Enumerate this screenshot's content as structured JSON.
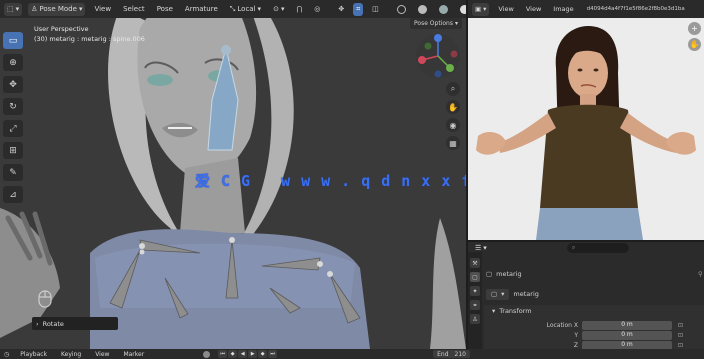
{
  "viewport_header": {
    "mode": "Pose Mode",
    "menus": [
      "View",
      "Select",
      "Pose",
      "Armature"
    ],
    "transform_space": "Local"
  },
  "viewport_info": {
    "perspective": "User Perspective",
    "context": "(30) metarig : metarig : spine.006"
  },
  "pose_options_label": "Pose Options",
  "watermark": "爱CG www.qdnxxfb.cn",
  "operator_panel": {
    "label": "Rotate"
  },
  "image_editor": {
    "menus": [
      "View",
      "View",
      "Image"
    ],
    "image_name": "d4094d4a4f7f1e5f86e2f8b0e3d1ba"
  },
  "properties": {
    "search_placeholder": "",
    "object_name": "metarig",
    "data_name": "metarig",
    "transform_label": "Transform",
    "location_label": "Location X",
    "location_rows": [
      {
        "axis": "Location X",
        "value": "0 m"
      },
      {
        "axis": "Y",
        "value": "0 m"
      },
      {
        "axis": "Z",
        "value": "0 m"
      }
    ]
  },
  "timeline": {
    "playback": "Playback",
    "keying": "Keying",
    "view": "View",
    "marker": "Marker",
    "end_label": "End",
    "end_value": "210"
  },
  "colors": {
    "accent": "#4772b3",
    "watermark": "#3b6ff0",
    "background": "#3b3b3b"
  },
  "icons": [
    "select-box-icon",
    "cursor-icon",
    "move-icon",
    "rotate-icon",
    "scale-icon",
    "transform-icon",
    "annotate-icon",
    "measure-icon"
  ]
}
